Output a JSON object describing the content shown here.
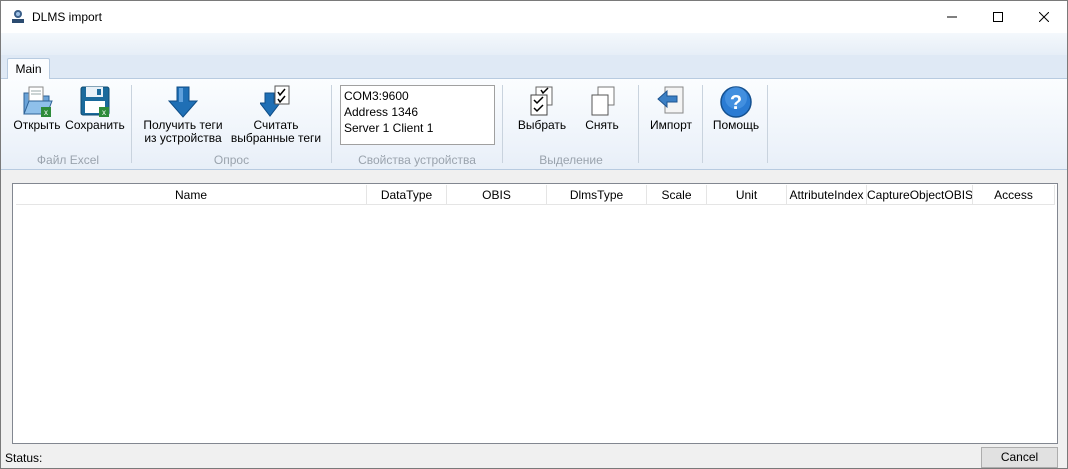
{
  "window": {
    "title": "DLMS import"
  },
  "ribbon": {
    "tabs": [
      {
        "label": "Main"
      }
    ],
    "groups": {
      "excel": {
        "label": "Файл Excel",
        "open_label": "Открыть",
        "save_label": "Сохранить"
      },
      "poll": {
        "label": "Опрос",
        "get_tags_line1": "Получить теги",
        "get_tags_line2": "из устройства",
        "read_line1": "Считать",
        "read_line2": "выбранные теги"
      },
      "device": {
        "label": "Свойства устройства",
        "line1": "COM3:9600",
        "line2": "Address 1346",
        "line3": "Server 1 Client 1"
      },
      "selection": {
        "label": "Выделение",
        "select_label": "Выбрать",
        "deselect_label": "Снять"
      },
      "import_label": "Импорт",
      "help_label": "Помощь"
    }
  },
  "grid": {
    "columns": [
      "Name",
      "DataType",
      "OBIS",
      "DlmsType",
      "Scale",
      "Unit",
      "AttributeIndex",
      "CaptureObjectOBIS",
      "Access"
    ],
    "rows": []
  },
  "status": {
    "label": "Status:",
    "cancel_label": "Cancel"
  },
  "icons": {
    "app": "dlms-app-icon",
    "open": "open-folder-icon",
    "save": "save-disk-icon",
    "get_tags": "arrow-down-icon",
    "read": "arrow-down-checklist-icon",
    "select": "checklist-icon",
    "deselect": "unchecked-list-icon",
    "import": "import-arrow-icon",
    "help": "help-icon"
  },
  "colors": {
    "ribbon_tab": "#dfe9f5",
    "accent_blue": "#1f6fb5",
    "help_blue": "#2a7bd3"
  }
}
